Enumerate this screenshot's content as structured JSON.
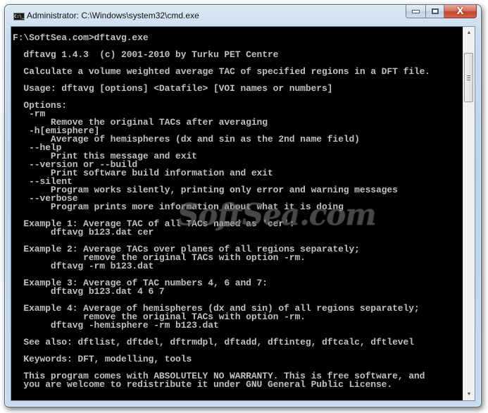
{
  "window": {
    "title": "Administrator: C:\\Windows\\system32\\cmd.exe",
    "icon": "cmd-icon",
    "icon_text": "C:\\_",
    "buttons": {
      "minimize": "minimize-icon",
      "maximize": "maximize-icon",
      "close": "close-icon",
      "close_glyph": "X"
    }
  },
  "console": {
    "lines": [
      "F:\\SoftSea.com>dftavg.exe",
      "",
      "  dftavg 1.4.3  (c) 2001-2010 by Turku PET Centre",
      "",
      "  Calculate a volume weighted average TAC of specified regions in a DFT file.",
      "",
      "  Usage: dftavg [options] <Datafile> [VOI names or numbers]",
      "",
      "  Options:",
      "   -rm",
      "       Remove the original TACs after averaging",
      "   -h[emisphere]",
      "       Average of hemispheres (dx and sin as the 2nd name field)",
      "   --help",
      "       Print this message and exit",
      "   --version or --build",
      "       Print software build information and exit",
      "   --silent",
      "       Program works silently, printing only error and warning messages",
      "   --verbose",
      "       Program prints more information about what it is doing",
      "",
      "  Example 1: Average TAC of all TACs named as 'cer':",
      "       dftavg b123.dat cer",
      "",
      "  Example 2: Average TACs over planes of all regions separately;",
      "             remove the original TACs with option -rm.",
      "       dftavg -rm b123.dat",
      "",
      "  Example 3: Average of TAC numbers 4, 6 and 7:",
      "       dftavg b123.dat 4 6 7",
      "",
      "  Example 4: Average of hemispheres (dx and sin) of all regions separately;",
      "             remove the original TACs with option -rm.",
      "       dftavg -hemisphere -rm b123.dat",
      "",
      "  See also: dftlist, dftdel, dftrmdpl, dftadd, dftinteg, dftcalc, dftlevel",
      "",
      "  Keywords: DFT, modelling, tools",
      "",
      "  This program comes with ABSOLUTELY NO WARRANTY. This is free software, and",
      "  you are welcome to redistribute it under GNU General Public License."
    ]
  },
  "scrollbar": {
    "up_arrow": "▲",
    "down_arrow": "▼"
  },
  "watermark": "SoftSea.com",
  "colors": {
    "console_bg": "#000000",
    "console_fg": "#c0c0c0",
    "close_button": "#c4442c"
  }
}
